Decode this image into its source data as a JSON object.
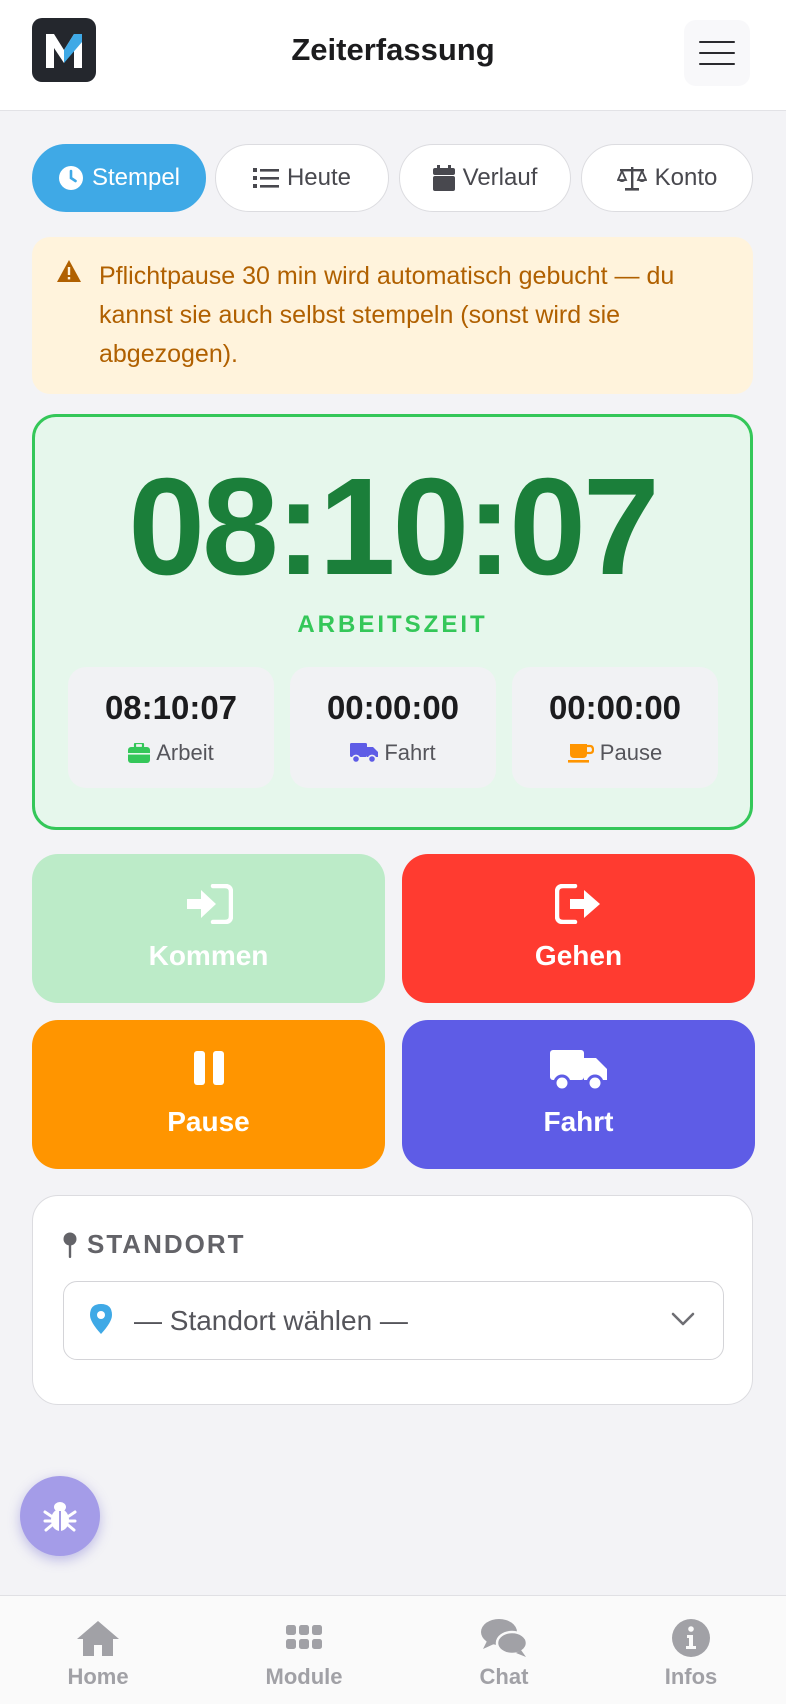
{
  "header": {
    "logo_letter": "M",
    "title": "Zeiterfassung",
    "menu_icon": "hamburger-menu-icon"
  },
  "tabs": [
    {
      "label": "Stempel",
      "icon": "clock-icon",
      "active": true
    },
    {
      "label": "Heute",
      "icon": "list-icon",
      "active": false
    },
    {
      "label": "Verlauf",
      "icon": "calendar-icon",
      "active": false
    },
    {
      "label": "Konto",
      "icon": "balance-scale-icon",
      "active": false
    }
  ],
  "alert": {
    "icon": "warning-icon",
    "text": "Pflichtpause 30 min wird automatisch gebucht — du kannst sie auch selbst stempeln (sonst wird sie abgezogen)."
  },
  "timer": {
    "main_value": "08:10:07",
    "main_label": "ARBEITSZEIT",
    "breakdown": [
      {
        "value": "08:10:07",
        "label": "Arbeit",
        "icon": "briefcase-icon",
        "color": "#34c759"
      },
      {
        "value": "00:00:00",
        "label": "Fahrt",
        "icon": "truck-icon",
        "color": "#5e5ce6"
      },
      {
        "value": "00:00:00",
        "label": "Pause",
        "icon": "coffee-icon",
        "color": "#ff9500"
      }
    ]
  },
  "actions": {
    "kommen": {
      "label": "Kommen",
      "icon": "sign-in-icon",
      "color": "#bcebc8",
      "enabled": false
    },
    "gehen": {
      "label": "Gehen",
      "icon": "sign-out-icon",
      "color": "#ff3b30",
      "enabled": true
    },
    "pause": {
      "label": "Pause",
      "icon": "pause-icon",
      "color": "#ff9500",
      "enabled": true
    },
    "fahrt": {
      "label": "Fahrt",
      "icon": "truck-icon",
      "color": "#5e5ce6",
      "enabled": true
    }
  },
  "standort": {
    "title": "STANDORT",
    "title_icon": "map-pin-icon",
    "select_icon": "location-marker-icon",
    "selected": "— Standort wählen —"
  },
  "floating": {
    "icon": "bug-icon"
  },
  "bottom_nav": [
    {
      "label": "Home",
      "icon": "home-icon"
    },
    {
      "label": "Module",
      "icon": "grid-icon"
    },
    {
      "label": "Chat",
      "icon": "chat-bubbles-icon"
    },
    {
      "label": "Infos",
      "icon": "info-circle-icon"
    }
  ]
}
